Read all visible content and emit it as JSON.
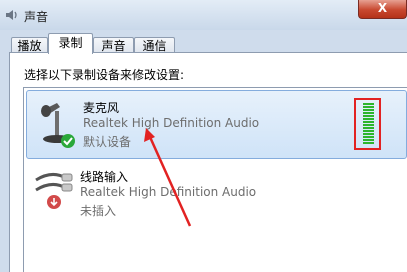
{
  "window": {
    "title": "声音",
    "close_label": "X"
  },
  "tabs": [
    {
      "label": "播放",
      "active": false
    },
    {
      "label": "录制",
      "active": true
    },
    {
      "label": "声音",
      "active": false
    },
    {
      "label": "通信",
      "active": false
    }
  ],
  "instruction": "选择以下录制设备来修改设置:",
  "devices": [
    {
      "name": "麦克风",
      "driver": "Realtek High Definition Audio",
      "status": "默认设备",
      "selected": true,
      "icon": "microphone-icon",
      "status_icon": "check-badge-icon"
    },
    {
      "name": "线路输入",
      "driver": "Realtek High Definition Audio",
      "status": "未插入",
      "selected": false,
      "icon": "line-in-cable-icon",
      "status_icon": "unplugged-badge-icon"
    }
  ],
  "level_meter": {
    "level": 1.0,
    "color": "#2db52d",
    "highlight_color": "#e22222"
  },
  "annotation": {
    "arrow_color": "#e22222"
  }
}
